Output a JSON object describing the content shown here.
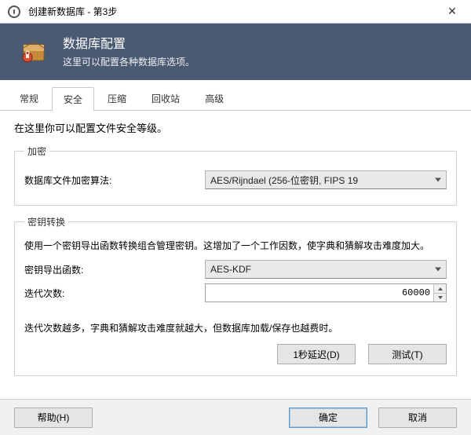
{
  "window": {
    "title": "创建新数据库  -  第3步"
  },
  "header": {
    "title": "数据库配置",
    "subtitle": "这里可以配置各种数据库选项。"
  },
  "tabs": [
    {
      "label": "常规"
    },
    {
      "label": "安全",
      "active": true
    },
    {
      "label": "压缩"
    },
    {
      "label": "回收站"
    },
    {
      "label": "高级"
    }
  ],
  "security": {
    "intro": "在这里你可以配置文件安全等级。",
    "encryption": {
      "legend": "加密",
      "algo_label": "数据库文件加密算法:",
      "algo_value": "AES/Rijndael (256-位密钥, FIPS 19"
    },
    "keytransform": {
      "legend": "密钥转换",
      "desc": "使用一个密钥导出函数转换组合管理密钥。这增加了一个工作因数，使字典和猜解攻击难度加大。",
      "kdf_label": "密钥导出函数:",
      "kdf_value": "AES-KDF",
      "iterations_label": "迭代次数:",
      "iterations_value": "60000",
      "note": "迭代次数越多，字典和猜解攻击难度就越大，但数据库加载/保存也越费时。",
      "delay_btn": "1秒延迟(D)",
      "test_btn": "测试(T)"
    }
  },
  "footer": {
    "help": "帮助(H)",
    "ok": "确定",
    "cancel": "取消"
  }
}
